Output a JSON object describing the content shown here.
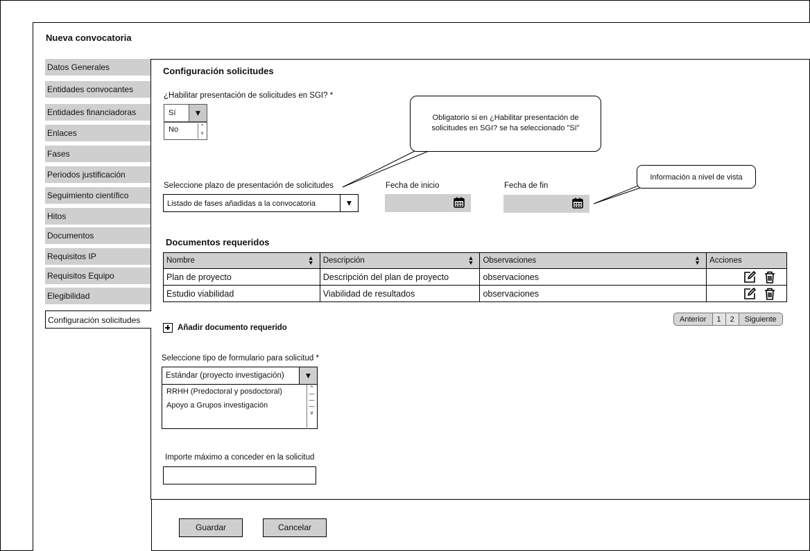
{
  "page": {
    "title": "Nueva convocatoria"
  },
  "sidebar": {
    "items": [
      {
        "label": "Datos Generales"
      },
      {
        "label": "Entidades convocantes"
      },
      {
        "label": "Entidades financiadoras"
      },
      {
        "label": "Enlaces"
      },
      {
        "label": "Fases"
      },
      {
        "label": "Periodos justificación"
      },
      {
        "label": "Seguimiento científico"
      },
      {
        "label": "Hitos"
      },
      {
        "label": "Documentos"
      },
      {
        "label": "Requisitos IP"
      },
      {
        "label": "Requisitos Equipo"
      },
      {
        "label": "Elegibilidad"
      },
      {
        "label": "Configuración solicitudes"
      }
    ]
  },
  "main": {
    "section_title": "Configuración solicitudes",
    "habilitar": {
      "label": "¿Habilitar presentación de solicitudes en SGI? *",
      "selected": "Sí",
      "options": [
        "No"
      ]
    },
    "callout_obligatorio": "Obligatorio si en ¿Habilitar presentación de solicitudes en SGI? se ha seleccionado \"Sí\"",
    "callout_info": "Información a nivel de vista",
    "plazo": {
      "label": "Seleccione plazo de presentación de solicitudes",
      "value": "Listado de fases añadidas a la convocatoria"
    },
    "fecha_inicio": {
      "label": "Fecha de inicio",
      "value": ""
    },
    "fecha_fin": {
      "label": "Fecha de fin",
      "value": ""
    },
    "documentos": {
      "title": "Documentos requeridos",
      "columns": [
        "Nombre",
        "Descripción",
        "Observaciones",
        "Acciones"
      ],
      "rows": [
        {
          "nombre": "Plan de proyecto",
          "descripcion": "Descripción del plan de proyecto",
          "observaciones": "observaciones"
        },
        {
          "nombre": "Estudio viabilidad",
          "descripcion": "Viabilidad de resultados",
          "observaciones": "observaciones"
        }
      ],
      "pager": {
        "prev": "Anterior",
        "pages": [
          "1",
          "2"
        ],
        "next": "Siguiente"
      },
      "add_label": "Añadir documento requerido"
    },
    "formulario": {
      "label": "Seleccione tipo de formulario para solicitud *",
      "selected": "Estándar (proyecto investigación)",
      "options": [
        "RRHH (Predoctoral y posdoctoral)",
        "Apoyo a Grupos investigación"
      ]
    },
    "importe": {
      "label": "Importe máximo a conceder en la solicitud",
      "value": ""
    }
  },
  "footer": {
    "save_label": "Guardar",
    "cancel_label": "Cancelar"
  },
  "icons": {
    "select_arrow": "triangle-down-icon",
    "calendar": "calendar-icon",
    "edit": "edit-icon",
    "delete": "trash-icon",
    "sort": "sort-icon",
    "add": "plus-square-icon"
  }
}
